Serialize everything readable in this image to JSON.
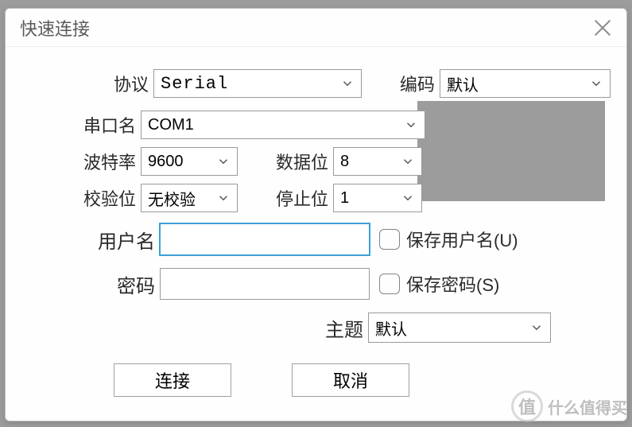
{
  "dialog": {
    "title": "快速连接"
  },
  "protocol": {
    "label": "协议",
    "value": "Serial"
  },
  "encoding": {
    "label": "编码",
    "value": "默认"
  },
  "port": {
    "label": "串口名",
    "value": "COM1"
  },
  "baud": {
    "label": "波特率",
    "value": "9600"
  },
  "dataBits": {
    "label": "数据位",
    "value": "8"
  },
  "parity": {
    "label": "校验位",
    "value": "无校验"
  },
  "stopBits": {
    "label": "停止位",
    "value": "1"
  },
  "username": {
    "label": "用户名",
    "value": "",
    "saveLabel": "保存用户名(U)"
  },
  "password": {
    "label": "密码",
    "value": "",
    "saveLabel": "保存密码(S)"
  },
  "theme": {
    "label": "主题",
    "value": "默认"
  },
  "buttons": {
    "connect": "连接",
    "cancel": "取消"
  },
  "watermark": {
    "badge": "值",
    "text": "什么值得买"
  }
}
